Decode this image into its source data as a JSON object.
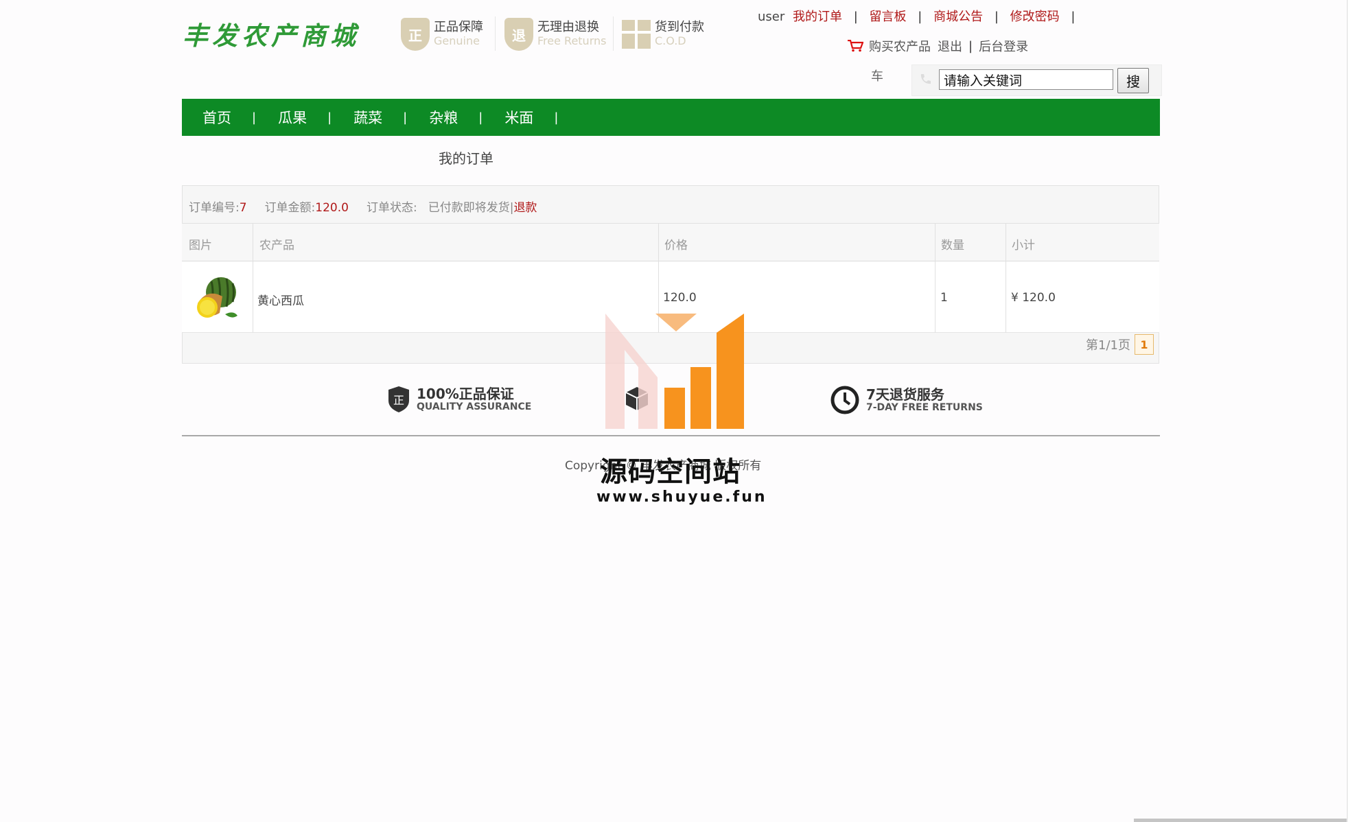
{
  "header": {
    "logo": "丰发农产商城",
    "badges": [
      {
        "icon": "genuine-shield-icon",
        "title": "正品保障",
        "subtitle": "Genuine",
        "glyph": "正"
      },
      {
        "icon": "return-shield-icon",
        "title": "无理由退换",
        "subtitle": "Free Returns",
        "glyph": "退"
      },
      {
        "icon": "gift-box-icon",
        "title": "货到付款",
        "subtitle": "C.O.D"
      }
    ],
    "user_name": "user",
    "links": {
      "my_orders": "我的订单",
      "message_board": "留言板",
      "announcements": "商城公告",
      "change_password": "修改密码",
      "separator": "|"
    },
    "cart": {
      "icon": "shopping-cart-icon",
      "label": "购买农产品",
      "label_tail": "车"
    },
    "logout": "退出",
    "admin_login": "后台登录",
    "search": {
      "value": "请输入关键词",
      "button": "搜",
      "icon": "phone-icon"
    }
  },
  "nav": {
    "items": [
      "首页",
      "瓜果",
      "蔬菜",
      "杂粮",
      "米面"
    ],
    "separator": "|"
  },
  "page_title": "我的订单",
  "order": {
    "id_label": "订单编号:",
    "id": "7",
    "amount_label": "订单金额:",
    "amount": "120.0",
    "status_label": "订单状态:",
    "status": "已付款即将发货|",
    "refund": "退款"
  },
  "table": {
    "headers": [
      "图片",
      "农产品",
      "价格",
      "数量",
      "小计"
    ],
    "rows": [
      {
        "image": "watermelon-image",
        "product": "黄心西瓜",
        "price": "120.0",
        "qty": "1",
        "subtotal": "¥ 120.0"
      }
    ]
  },
  "pager": {
    "text": "第1/1页",
    "current": "1"
  },
  "services": [
    {
      "icon": "shield-check-icon",
      "title": "100%正品保证",
      "subtitle": "QUALITY ASSURANCE"
    },
    {
      "icon": "box-icon",
      "title": "",
      "subtitle": ""
    },
    {
      "icon": "clock-icon",
      "title": "7天退货服务",
      "subtitle": "7-DAY FREE RETURNS"
    }
  ],
  "footer": {
    "copyright": "Copyright © 丰发农产商城 版权所有"
  },
  "watermark": {
    "title": "源码空间站",
    "url": "www.shuyue.fun"
  },
  "colors": {
    "nav_green": "#0d8a25",
    "link_red": "#b01919",
    "logo_green": "#2f9a37",
    "watermark_orange": "#f7931e"
  }
}
